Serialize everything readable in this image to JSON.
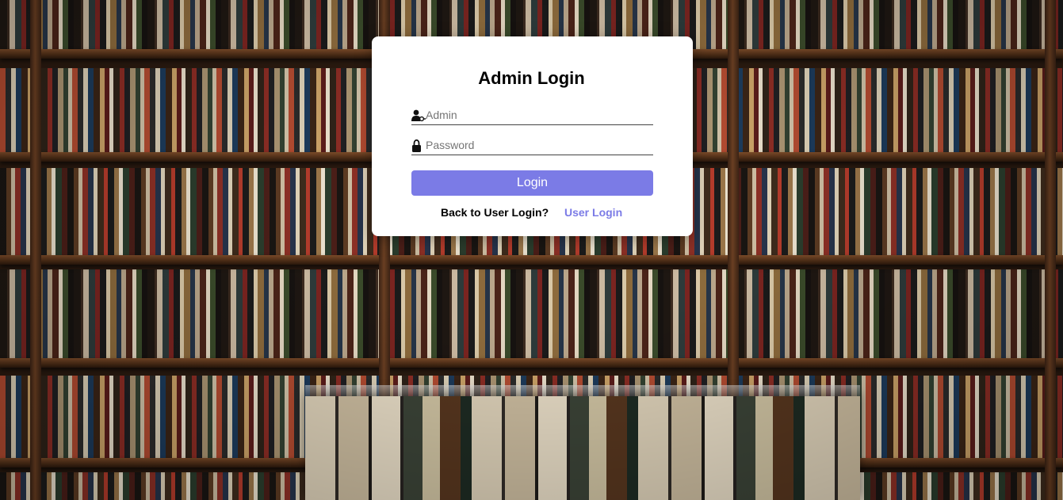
{
  "login": {
    "title": "Admin Login",
    "username_placeholder": "Admin",
    "password_placeholder": "Password",
    "submit_label": "Login",
    "back_prompt": "Back to User Login?",
    "back_link_label": "User Login"
  },
  "icons": {
    "username": "user-key-icon",
    "password": "lock-icon"
  },
  "colors": {
    "accent": "#7b7be6",
    "card": "#ffffff",
    "title_text": "#000000"
  }
}
